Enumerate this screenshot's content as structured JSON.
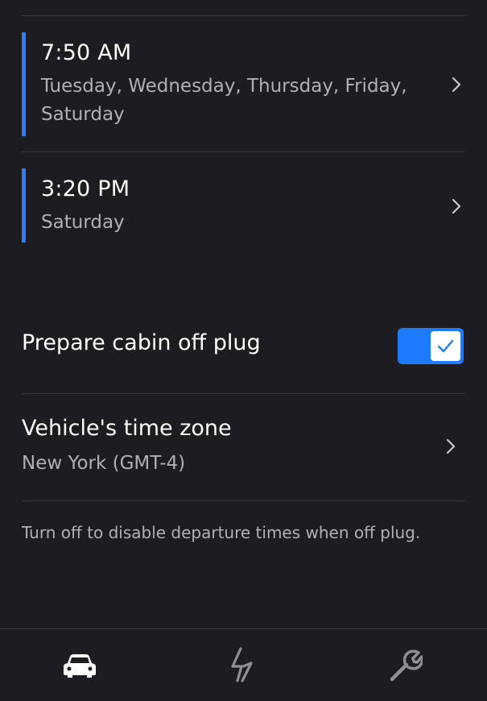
{
  "schedules": [
    {
      "time": "7:50 AM",
      "days": "Tuesday, Wednesday, Thursday, Friday, Saturday",
      "accent_color": "#2a7fff"
    },
    {
      "time": "3:20 PM",
      "days": "Saturday",
      "accent_color": "#2a7fff"
    }
  ],
  "prepare_cabin": {
    "label": "Prepare cabin off plug",
    "enabled": true,
    "toggle_color": "#1d7bff"
  },
  "time_zone": {
    "title": "Vehicle's time zone",
    "value": "New York (GMT-4)"
  },
  "helper_text": "Turn off to disable departure times when off plug.",
  "tab_bar": {
    "tabs": [
      {
        "icon": "car-icon",
        "active": true
      },
      {
        "icon": "lightning-icon",
        "active": false
      },
      {
        "icon": "wrench-icon",
        "active": false
      }
    ]
  },
  "colors": {
    "background": "#1c1c21",
    "divider": "#35353b",
    "primary_text": "#ffffff",
    "secondary_text": "#b0b0b6",
    "accent": "#1d7bff"
  }
}
